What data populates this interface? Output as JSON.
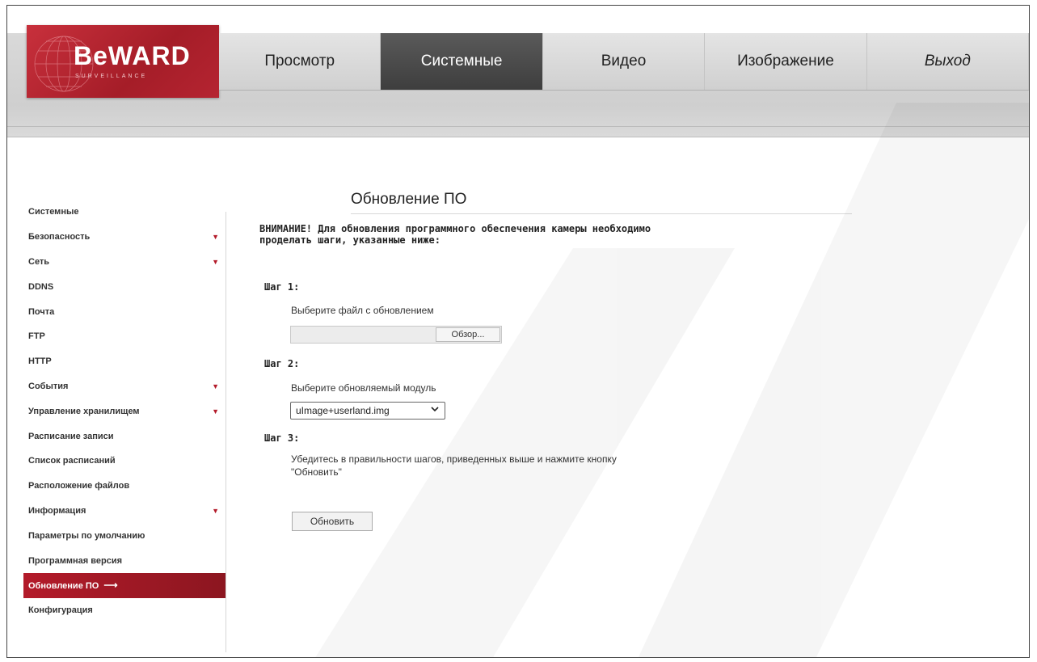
{
  "brand": {
    "logo_text": "BeWARD",
    "logo_sub": "SURVEILLANCE",
    "accent": "#b31b2a"
  },
  "nav": {
    "items": [
      {
        "label": "Просмотр",
        "active": false
      },
      {
        "label": "Системные",
        "active": true
      },
      {
        "label": "Видео",
        "active": false
      },
      {
        "label": "Изображение",
        "active": false
      },
      {
        "label": "Выход",
        "active": false
      }
    ]
  },
  "sidebar": {
    "items": [
      {
        "label": "Системные",
        "expandable": false
      },
      {
        "label": "Безопасность",
        "expandable": true
      },
      {
        "label": "Сеть",
        "expandable": true
      },
      {
        "label": "DDNS",
        "expandable": false
      },
      {
        "label": "Почта",
        "expandable": false
      },
      {
        "label": "FTP",
        "expandable": false
      },
      {
        "label": "HTTP",
        "expandable": false
      },
      {
        "label": "События",
        "expandable": true
      },
      {
        "label": "Управление хранилищем",
        "expandable": true
      },
      {
        "label": "Расписание записи",
        "expandable": false
      },
      {
        "label": "Список расписаний",
        "expandable": false
      },
      {
        "label": "Расположение файлов",
        "expandable": false
      },
      {
        "label": "Информация",
        "expandable": true
      },
      {
        "label": "Параметры по умолчанию",
        "expandable": false
      },
      {
        "label": "Программная версия",
        "expandable": false
      },
      {
        "label": "Обновление ПО",
        "expandable": false,
        "active": true
      },
      {
        "label": "Конфигурация",
        "expandable": false
      }
    ]
  },
  "main": {
    "title": "Обновление ПО",
    "warning_line1": "ВНИМАНИЕ! Для обновления программного обеспечения камеры необходимо",
    "warning_line2": "проделать шаги, указанные ниже:",
    "step1": {
      "label": "Шаг 1:",
      "text": "Выберите файл с обновлением",
      "browse_label": "Обзор..."
    },
    "step2": {
      "label": "Шаг 2:",
      "text": "Выберите обновляемый модуль",
      "selected_module": "uImage+userland.img"
    },
    "step3": {
      "label": "Шаг 3:",
      "text_line1": "Убедитесь в правильности шагов, приведенных выше и нажмите кнопку",
      "text_line2": "\"Обновить\"",
      "update_label": "Обновить"
    }
  }
}
